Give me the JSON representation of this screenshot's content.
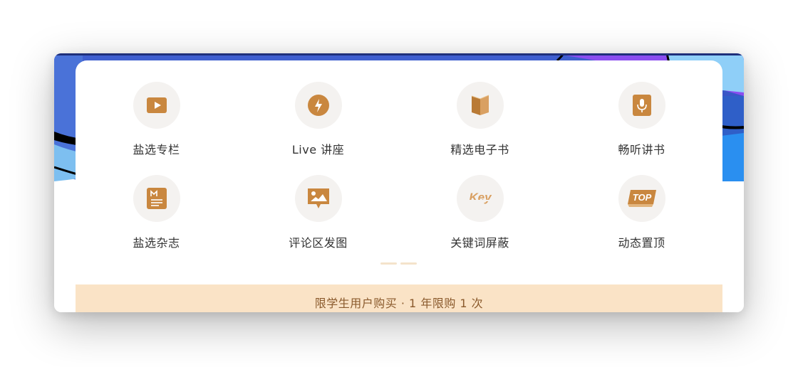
{
  "colors": {
    "accent_gold": "#c9873f",
    "promo_bg": "#fae3c6",
    "promo_text": "#8a5a2c",
    "label_text": "#333333",
    "icon_circle": "#f4f2f0"
  },
  "features": [
    {
      "label": "盐选专栏",
      "icon": "play-icon"
    },
    {
      "label": "Live 讲座",
      "icon": "lightning-icon"
    },
    {
      "label": "精选电子书",
      "icon": "book-icon"
    },
    {
      "label": "畅听讲书",
      "icon": "microphone-icon"
    },
    {
      "label": "盐选杂志",
      "icon": "magazine-icon"
    },
    {
      "label": "评论区发图",
      "icon": "image-comment-icon"
    },
    {
      "label": "关键词屏蔽",
      "icon": "key-icon"
    },
    {
      "label": "动态置顶",
      "icon": "top-icon"
    }
  ],
  "pagination": {
    "pages": 2
  },
  "promo": {
    "text": "限学生用户购买 · 1 年限购 1 次"
  }
}
